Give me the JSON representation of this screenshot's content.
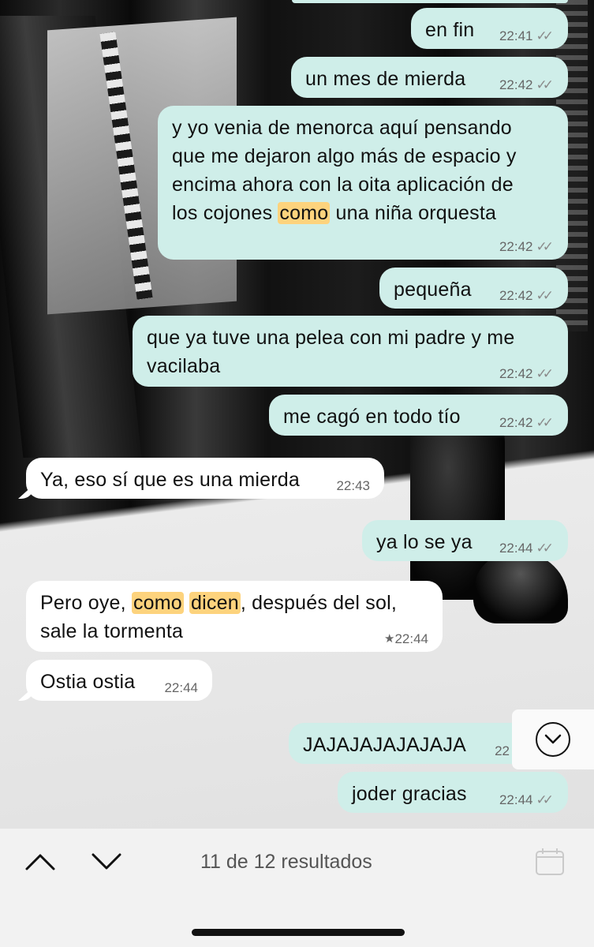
{
  "messages": [
    {
      "dir": "out",
      "text": "en fin",
      "time": "22:41",
      "ticks": "✓✓"
    },
    {
      "dir": "out",
      "text": "un mes de mierda",
      "time": "22:42",
      "ticks": "✓✓"
    },
    {
      "dir": "out",
      "lines": [
        "y yo venia de menorca aquí pensando",
        "que me dejaron algo más de espacio y",
        "encima ahora con la oita aplicación de"
      ],
      "line4_before": "los cojones ",
      "line4_highlight": "como",
      "line4_after": " una niña orquesta",
      "time": "22:42",
      "ticks": "✓✓"
    },
    {
      "dir": "out",
      "text": "pequeña",
      "time": "22:42",
      "ticks": "✓✓"
    },
    {
      "dir": "out",
      "lines": [
        "que ya tuve una pelea con mi padre y me",
        "vacilaba"
      ],
      "time": "22:42",
      "ticks": "✓✓"
    },
    {
      "dir": "out",
      "text": "me cagó en todo tío",
      "time": "22:42",
      "ticks": "✓✓"
    },
    {
      "dir": "in",
      "text": "Ya, eso sí que es una mierda",
      "time": "22:43"
    },
    {
      "dir": "out",
      "text": "ya lo se ya",
      "time": "22:44",
      "ticks": "✓✓"
    },
    {
      "dir": "in",
      "line1_before": "Pero oye, ",
      "highlight1": "como",
      "highlight2": "dicen",
      "line1_after": ", después del sol,",
      "line2": "sale la tormenta",
      "time": "22:44",
      "starred": "★"
    },
    {
      "dir": "in",
      "text": "Ostia ostia",
      "time": "22:44"
    },
    {
      "dir": "out",
      "text": "JAJAJAJAJAJAJA",
      "time": "22"
    },
    {
      "dir": "out",
      "text": "joder gracias",
      "time": "22:44",
      "ticks": "✓✓"
    }
  ],
  "search": {
    "results_text": "11 de 12 resultados"
  },
  "icons": {
    "up": "chevron-up-icon",
    "down": "chevron-down-icon",
    "scroll": "scroll-to-bottom-icon",
    "calendar": "calendar-icon"
  },
  "colors": {
    "outgoing": "#cfeee9",
    "incoming": "#ffffff",
    "highlight": "#fdd37d"
  }
}
